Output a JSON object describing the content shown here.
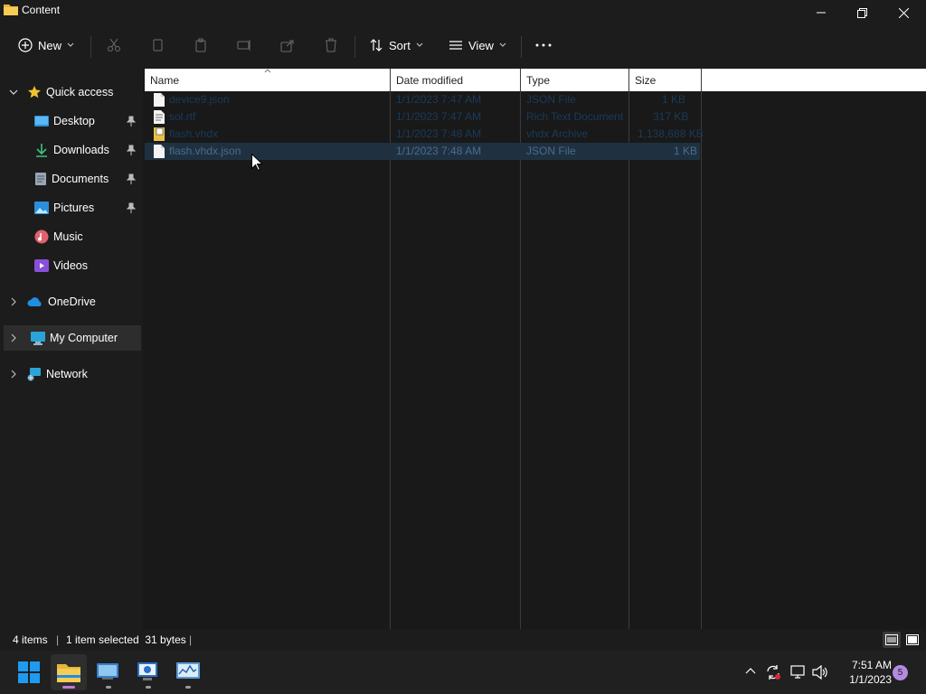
{
  "window": {
    "title": "Content"
  },
  "toolbar": {
    "new_label": "New",
    "sort_label": "Sort",
    "view_label": "View"
  },
  "sidebar": {
    "quick_access": "Quick access",
    "items": [
      {
        "label": "Desktop"
      },
      {
        "label": "Downloads"
      },
      {
        "label": "Documents"
      },
      {
        "label": "Pictures"
      },
      {
        "label": "Music"
      },
      {
        "label": "Videos"
      }
    ],
    "onedrive": "OneDrive",
    "my_computer": "My Computer",
    "network": "Network"
  },
  "columns": {
    "name": "Name",
    "date": "Date modified",
    "type": "Type",
    "size": "Size"
  },
  "files": [
    {
      "name": "device9.json",
      "date": "1/1/2023 7:47 AM",
      "type": "JSON File",
      "size": "1 KB"
    },
    {
      "name": "sol.rtf",
      "date": "1/1/2023 7:47 AM",
      "type": "Rich Text Document",
      "size": "317 KB"
    },
    {
      "name": "flash.vhdx",
      "date": "1/1/2023 7:48 AM",
      "type": "vhdx Archive",
      "size": "1,138,688 KB"
    },
    {
      "name": "flash.vhdx.json",
      "date": "1/1/2023 7:48 AM",
      "type": "JSON File",
      "size": "1 KB"
    }
  ],
  "status": {
    "items": "4 items",
    "selected": "1 item selected  31 bytes"
  },
  "taskbar": {
    "time": "7:51 AM",
    "date": "1/1/2023",
    "notification_count": "5"
  }
}
